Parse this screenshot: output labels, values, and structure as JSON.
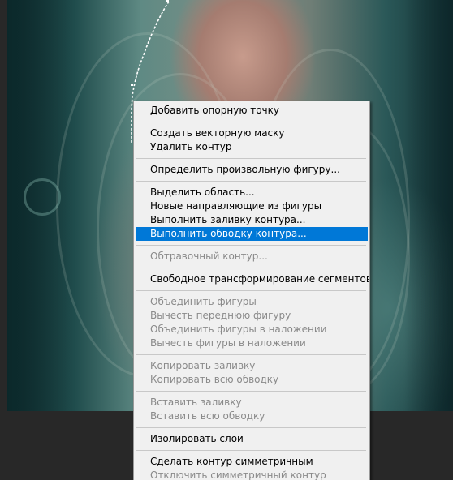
{
  "canvas": {
    "name": "portrait-photo"
  },
  "context_menu": {
    "items": [
      {
        "label": "Добавить опорную точку",
        "enabled": true,
        "highlighted": false
      },
      {
        "label": "Создать векторную маску",
        "enabled": true,
        "highlighted": false
      },
      {
        "label": "Удалить контур",
        "enabled": true,
        "highlighted": false
      },
      {
        "label": "Определить произвольную фигуру...",
        "enabled": true,
        "highlighted": false
      },
      {
        "label": "Выделить область...",
        "enabled": true,
        "highlighted": false
      },
      {
        "label": "Новые направляющие из фигуры",
        "enabled": true,
        "highlighted": false
      },
      {
        "label": "Выполнить заливку контура...",
        "enabled": true,
        "highlighted": false
      },
      {
        "label": "Выполнить обводку контура...",
        "enabled": true,
        "highlighted": true
      },
      {
        "label": "Обтравочный контур...",
        "enabled": false,
        "highlighted": false
      },
      {
        "label": "Свободное трансформирование сегментов",
        "enabled": true,
        "highlighted": false
      },
      {
        "label": "Объединить фигуры",
        "enabled": false,
        "highlighted": false
      },
      {
        "label": "Вычесть переднюю фигуру",
        "enabled": false,
        "highlighted": false
      },
      {
        "label": "Объединить фигуры в наложении",
        "enabled": false,
        "highlighted": false
      },
      {
        "label": "Вычесть фигуры в наложении",
        "enabled": false,
        "highlighted": false
      },
      {
        "label": "Копировать заливку",
        "enabled": false,
        "highlighted": false
      },
      {
        "label": "Копировать всю обводку",
        "enabled": false,
        "highlighted": false
      },
      {
        "label": "Вставить заливку",
        "enabled": false,
        "highlighted": false
      },
      {
        "label": "Вставить всю обводку",
        "enabled": false,
        "highlighted": false
      },
      {
        "label": "Изолировать слои",
        "enabled": true,
        "highlighted": false
      },
      {
        "label": "Сделать контур симметричным",
        "enabled": true,
        "highlighted": false
      },
      {
        "label": "Отключить симметричный контур",
        "enabled": false,
        "highlighted": false
      }
    ]
  },
  "colors": {
    "workspace_bg": "#282828",
    "menu_bg": "#f0f0f0",
    "highlight": "#0078d7",
    "disabled_text": "#8a8a8a"
  }
}
